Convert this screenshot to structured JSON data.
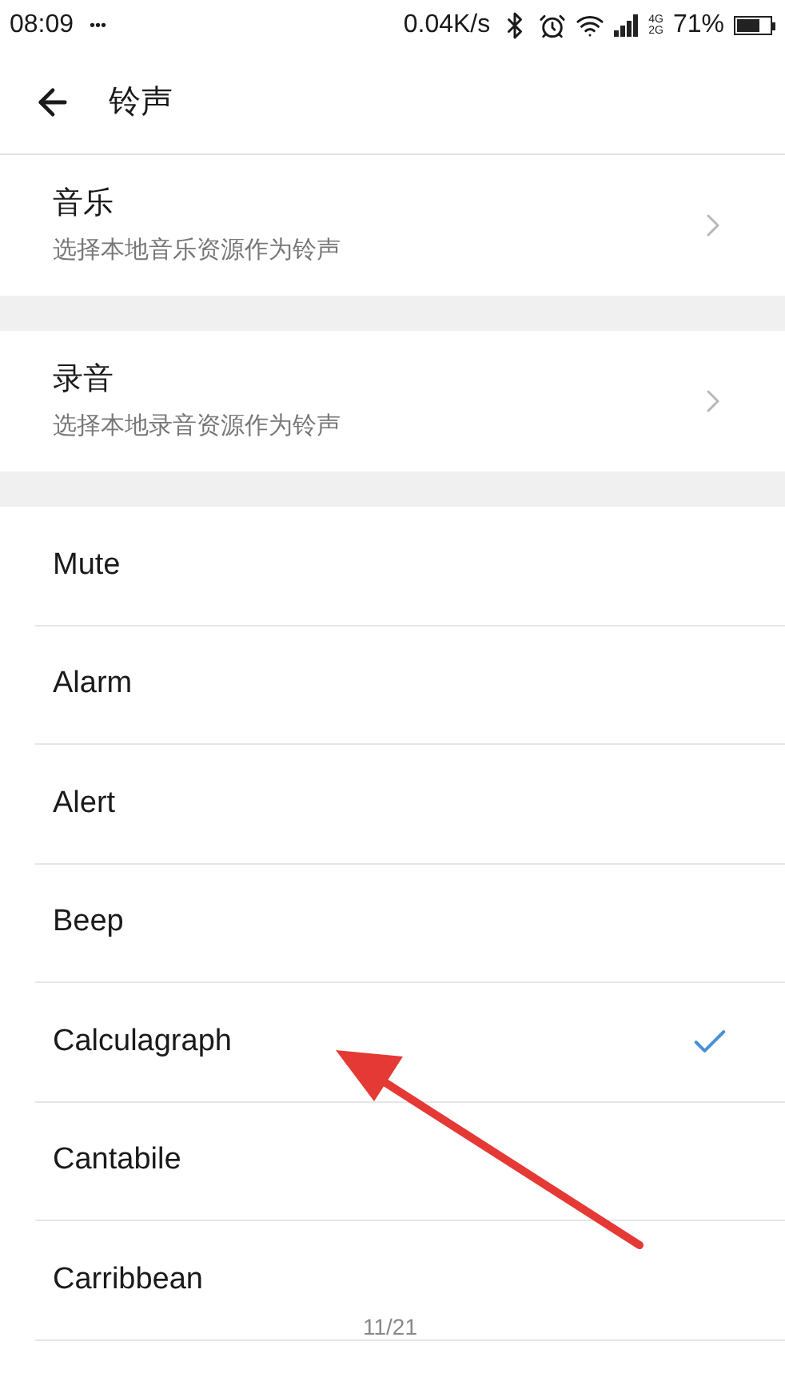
{
  "status_bar": {
    "time": "08:09",
    "more": "•••",
    "speed": "0.04K/s",
    "network_top": "4G",
    "network_bottom": "2G",
    "battery": "71%"
  },
  "header": {
    "title": "铃声"
  },
  "sources": [
    {
      "title": "音乐",
      "subtitle": "选择本地音乐资源作为铃声"
    },
    {
      "title": "录音",
      "subtitle": "选择本地录音资源作为铃声"
    }
  ],
  "ringtones": [
    {
      "label": "Mute",
      "selected": false
    },
    {
      "label": "Alarm",
      "selected": false
    },
    {
      "label": "Alert",
      "selected": false
    },
    {
      "label": "Beep",
      "selected": false
    },
    {
      "label": "Calculagraph",
      "selected": true
    },
    {
      "label": "Cantabile",
      "selected": false
    },
    {
      "label": "Carribbean",
      "selected": false
    }
  ],
  "page_indicator": "11/21"
}
